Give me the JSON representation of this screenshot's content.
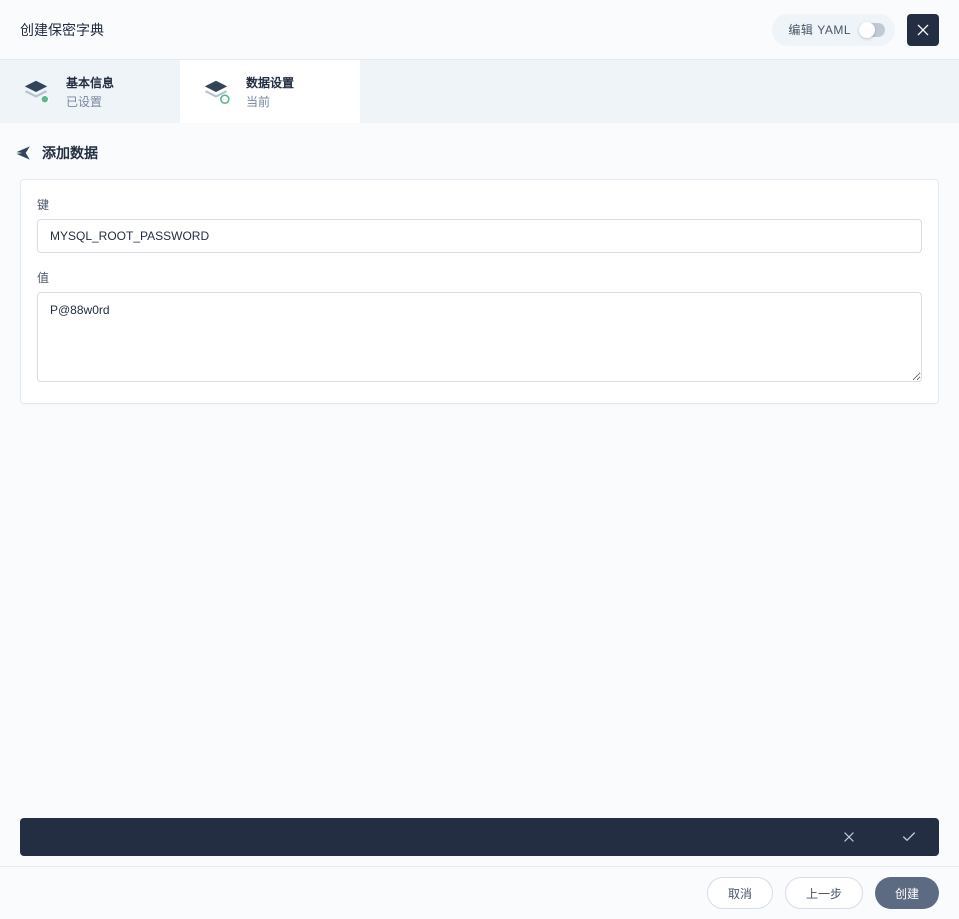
{
  "header": {
    "title": "创建保密字典",
    "yaml_label": "编辑 YAML"
  },
  "steps": [
    {
      "title": "基本信息",
      "status": "已设置"
    },
    {
      "title": "数据设置",
      "status": "当前"
    }
  ],
  "section": {
    "title": "添加数据"
  },
  "form": {
    "key_label": "键",
    "key_value": "MYSQL_ROOT_PASSWORD",
    "value_label": "值",
    "value_value": "P@88w0rd"
  },
  "footer": {
    "cancel": "取消",
    "prev": "上一步",
    "create": "创建"
  }
}
